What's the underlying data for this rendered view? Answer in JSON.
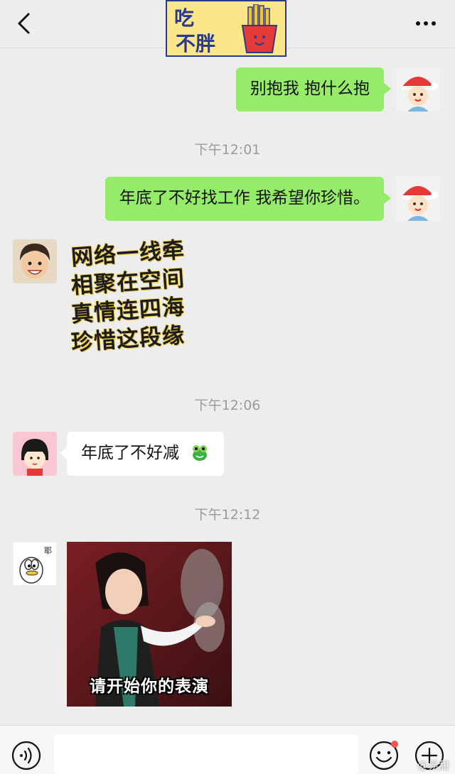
{
  "header": {
    "logo_line1": "吃",
    "logo_line2": "不胖",
    "back_icon": "chevron-left-icon",
    "more_icon": "more-dots-icon"
  },
  "messages": [
    {
      "side": "right",
      "type": "text",
      "text": "别抱我 抱什么抱"
    },
    {
      "type": "time",
      "text": "下午12:01"
    },
    {
      "side": "right",
      "type": "text",
      "text": "年底了不好找工作 我希望你珍惜。"
    },
    {
      "side": "left",
      "type": "sticker",
      "lines": [
        "网络一线牵",
        "相聚在空间",
        "真情连四海",
        "珍惜这段缘"
      ]
    },
    {
      "type": "time",
      "text": "下午12:06"
    },
    {
      "side": "left",
      "type": "text",
      "text": "年底了不好减",
      "emoji": "frog-emoji"
    },
    {
      "type": "time",
      "text": "下午12:12"
    },
    {
      "side": "left",
      "type": "image",
      "caption": "请开始你的表演",
      "avatar_text": "耶"
    }
  ],
  "input": {
    "placeholder": "",
    "value": ""
  },
  "watermark": "@易甜",
  "colors": {
    "my_bubble": "#95ec69",
    "their_bubble": "#ffffff",
    "background": "#ededed",
    "badge": "#fa5151"
  }
}
